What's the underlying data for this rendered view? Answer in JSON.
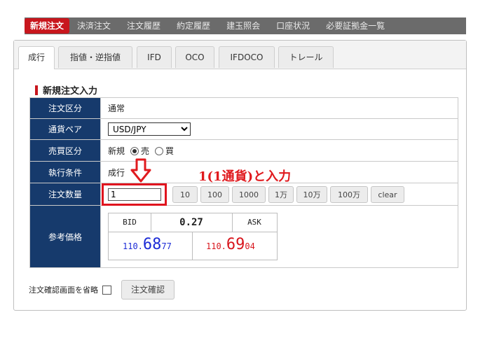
{
  "nav": {
    "items": [
      "新規注文",
      "決済注文",
      "注文履歴",
      "約定履歴",
      "建玉照会",
      "口座状況",
      "必要証拠金一覧"
    ],
    "active_index": 0
  },
  "tabs": [
    "成行",
    "指値・逆指値",
    "IFD",
    "OCO",
    "IFDOCO",
    "トレール"
  ],
  "section_title": "新規注文入力",
  "form": {
    "order_type_label": "注文区分",
    "order_type_value": "通常",
    "currency_pair_label": "通貨ペア",
    "currency_pair_value": "USD/JPY",
    "side_label": "売買区分",
    "side_prefix": "新規",
    "side_sell": "売",
    "side_buy": "買",
    "side_selected": "売",
    "exec_label": "執行条件",
    "exec_value": "成行",
    "qty_label": "注文数量",
    "qty_value": "1",
    "qty_buttons": [
      "10",
      "100",
      "1000",
      "1万",
      "10万",
      "100万",
      "clear"
    ],
    "ref_price_label": "参考価格"
  },
  "price": {
    "bid_label": "BID",
    "spread": "0.27",
    "ask_label": "ASK",
    "bid_prefix": "110.",
    "bid_big": "68",
    "bid_tail": "77",
    "ask_prefix": "110.",
    "ask_big": "69",
    "ask_tail": "04"
  },
  "annotation": "1(1通貨)と入力",
  "footer": {
    "skip_confirm_label": "注文確認画面を省略",
    "confirm_button": "注文確認"
  },
  "colors": {
    "accent_red": "#c8161d",
    "label_navy": "#163a6c",
    "bid_blue": "#1c2bd6",
    "ask_red": "#d8161d",
    "annotation_red": "#e01a1e"
  }
}
